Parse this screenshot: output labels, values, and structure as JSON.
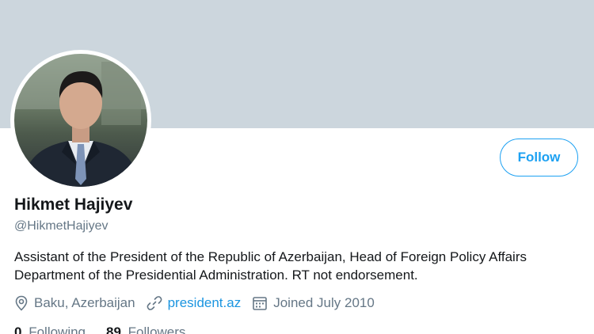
{
  "profile": {
    "name": "Hikmet Hajiyev",
    "handle": "@HikmetHajiyev",
    "bio": "Assistant of the President of the Republic of Azerbaijan, Head of Foreign Policy Affairs Department of the Presidential Administration.  RT not endorsement.",
    "location": "Baku, Azerbaijan",
    "website": "president.az",
    "joined": "Joined July 2010"
  },
  "actions": {
    "follow_label": "Follow"
  },
  "stats": {
    "following_count": "0",
    "following_label": "Following",
    "followers_count": "89",
    "followers_label": "Followers"
  },
  "icons": {
    "location": "location-pin-icon",
    "link": "link-icon",
    "calendar": "calendar-icon"
  },
  "colors": {
    "accent": "#1da1f2",
    "banner": "#ccd6dd",
    "secondary_text": "#657786"
  }
}
